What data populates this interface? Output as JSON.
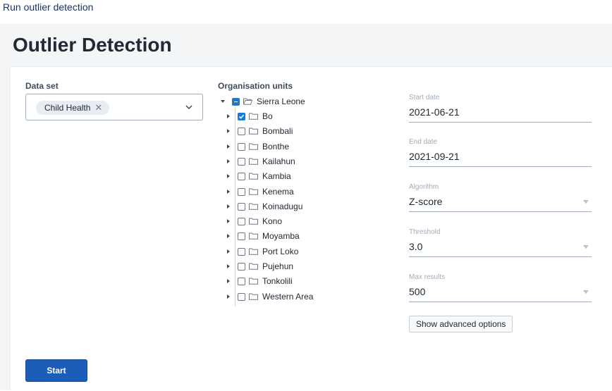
{
  "top_link": "Run outlier detection",
  "title": "Outlier Detection",
  "dataset": {
    "label": "Data set",
    "selected_chip": "Child Health",
    "chip_remove_symbol": "✕"
  },
  "org_units": {
    "label": "Organisation units",
    "root": "Sierra Leone",
    "children": [
      {
        "name": "Bo",
        "checked": true
      },
      {
        "name": "Bombali",
        "checked": false
      },
      {
        "name": "Bonthe",
        "checked": false
      },
      {
        "name": "Kailahun",
        "checked": false
      },
      {
        "name": "Kambia",
        "checked": false
      },
      {
        "name": "Kenema",
        "checked": false
      },
      {
        "name": "Koinadugu",
        "checked": false
      },
      {
        "name": "Kono",
        "checked": false
      },
      {
        "name": "Moyamba",
        "checked": false
      },
      {
        "name": "Port Loko",
        "checked": false
      },
      {
        "name": "Pujehun",
        "checked": false
      },
      {
        "name": "Tonkolili",
        "checked": false
      },
      {
        "name": "Western Area",
        "checked": false
      }
    ]
  },
  "fields": {
    "start_date": {
      "label": "Start date",
      "value": "2021-06-21"
    },
    "end_date": {
      "label": "End date",
      "value": "2021-09-21"
    },
    "algorithm": {
      "label": "Algorithm",
      "value": "Z-score"
    },
    "threshold": {
      "label": "Threshold",
      "value": "3.0"
    },
    "max_results": {
      "label": "Max results",
      "value": "500"
    }
  },
  "buttons": {
    "advanced": "Show advanced options",
    "start": "Start"
  },
  "colors": {
    "primary": "#1b5db8",
    "checkbox": "#147cd7",
    "panel_bg": "#f3f5f7"
  }
}
